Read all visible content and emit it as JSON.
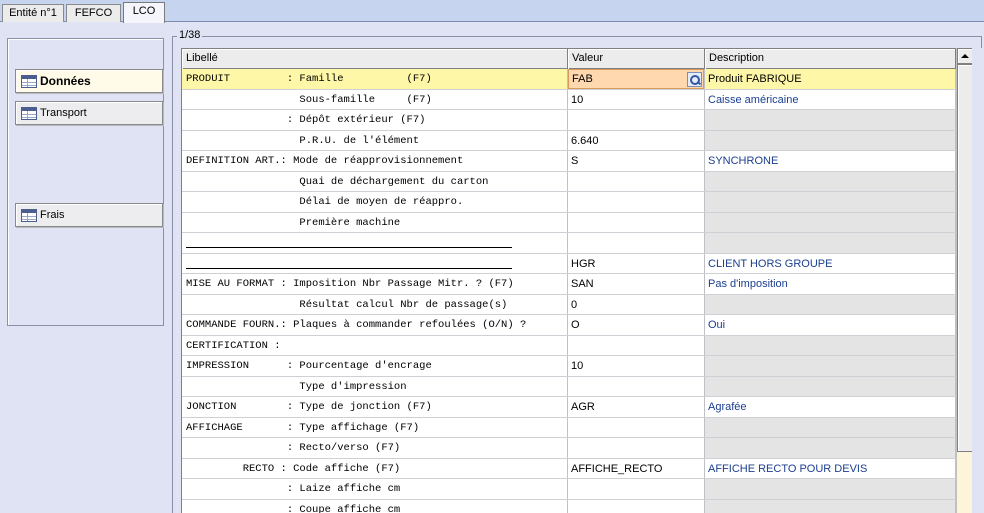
{
  "tabs": [
    {
      "label": "Entité n°1"
    },
    {
      "label": "FEFCO"
    },
    {
      "label": "LCO",
      "active": true
    }
  ],
  "sidebar": {
    "buttons": [
      {
        "label": "Données",
        "active": true,
        "icon": "grid-icon"
      },
      {
        "label": "Transport",
        "icon": "grid-icon"
      },
      {
        "label": "Frais",
        "icon": "grid-icon"
      }
    ]
  },
  "group": {
    "counter": "1/38"
  },
  "table": {
    "headers": {
      "libelle": "Libellé",
      "valeur": "Valeur",
      "description": "Description"
    },
    "rows": [
      {
        "lib": "PRODUIT         : Famille          (F7)",
        "val": "FAB",
        "desc": "Produit FABRIQUE",
        "selected": true,
        "lookup": true
      },
      {
        "lib": "                  Sous-famille     (F7)",
        "val": "10",
        "desc": "Caisse américaine"
      },
      {
        "lib": "                : Dépôt extérieur (F7)",
        "val": "",
        "desc": ""
      },
      {
        "lib": "                  P.R.U. de l'élément",
        "val": "6.640",
        "desc": ""
      },
      {
        "lib": "DEFINITION ART.: Mode de réapprovisionnement",
        "val": "S",
        "desc": "SYNCHRONE"
      },
      {
        "lib": "                  Quai de déchargement du carton",
        "val": "",
        "desc": ""
      },
      {
        "lib": "                  Délai de moyen de réappro.",
        "val": "",
        "desc": ""
      },
      {
        "lib": "                  Première machine",
        "val": "",
        "desc": ""
      },
      {
        "lib": "",
        "val": "",
        "desc": "",
        "separator": true
      },
      {
        "lib": "",
        "val": "HGR",
        "desc": "CLIENT HORS GROUPE",
        "separator": true
      },
      {
        "lib": "MISE AU FORMAT : Imposition Nbr Passage Mitr. ? (F7)",
        "val": "SAN",
        "desc": "Pas d'imposition"
      },
      {
        "lib": "                  Résultat calcul Nbr de passage(s)",
        "val": "0",
        "desc": ""
      },
      {
        "lib": "COMMANDE FOURN.: Plaques à commander refoulées (O/N) ?",
        "val": "O",
        "desc": "Oui"
      },
      {
        "lib": "CERTIFICATION :",
        "val": "",
        "desc": ""
      },
      {
        "lib": "IMPRESSION      : Pourcentage d'encrage",
        "val": "10",
        "desc": ""
      },
      {
        "lib": "                  Type d'impression",
        "val": "",
        "desc": ""
      },
      {
        "lib": "JONCTION        : Type de jonction (F7)",
        "val": "AGR",
        "desc": "Agrafée"
      },
      {
        "lib": "AFFICHAGE       : Type affichage (F7)",
        "val": "",
        "desc": ""
      },
      {
        "lib": "                : Recto/verso (F7)",
        "val": "",
        "desc": ""
      },
      {
        "lib": "         RECTO : Code affiche (F7)",
        "val": "AFFICHE_RECTO",
        "desc": "AFFICHE RECTO POUR DEVIS"
      },
      {
        "lib": "                : Laize affiche cm",
        "val": "",
        "desc": ""
      },
      {
        "lib": "                : Coupe affiche cm",
        "val": "",
        "desc": ""
      }
    ]
  }
}
